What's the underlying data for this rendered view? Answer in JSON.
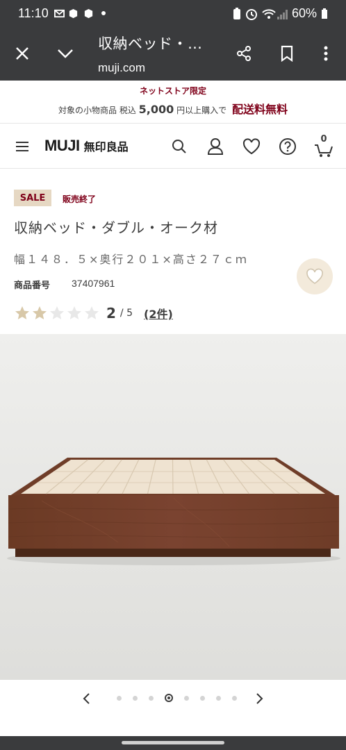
{
  "status_bar": {
    "time": "11:10",
    "battery": "60%"
  },
  "tab": {
    "title": "収納ベッド・…",
    "url": "muji.com"
  },
  "promo": {
    "headline": "ネットストア限定",
    "prefix": "対象の小物商品 税込",
    "amount": "5,000",
    "suffix": "円以上購入で",
    "highlight": "配送料無料"
  },
  "header": {
    "logo_en": "MUJI",
    "logo_jp": "無印良品",
    "cart_count": "0"
  },
  "product": {
    "badge": "SALE",
    "status": "販売終了",
    "name": "収納ベッド・ダブル・オーク材",
    "size": "幅１４８．５×奥行２０１×高さ２７ｃｍ",
    "code_label": "商品番号",
    "code": "37407961",
    "rating_value": 2,
    "rating_max": 5,
    "rating_score": "2",
    "rating_out_of": "/ 5",
    "reviews": "(2件)"
  },
  "carousel": {
    "total": 8,
    "active_index": 3
  },
  "colors": {
    "accent": "#7f0019",
    "badge_bg": "#e6d8c3",
    "star_filled": "#d8c8a8",
    "star_empty": "#e8e8e8"
  },
  "icons": [
    "close-icon",
    "chevron-down-icon",
    "share-icon",
    "bookmark-icon",
    "more-vert-icon",
    "menu-icon",
    "search-icon",
    "user-icon",
    "heart-icon",
    "help-icon",
    "cart-icon",
    "chevron-left-icon",
    "chevron-right-icon"
  ]
}
